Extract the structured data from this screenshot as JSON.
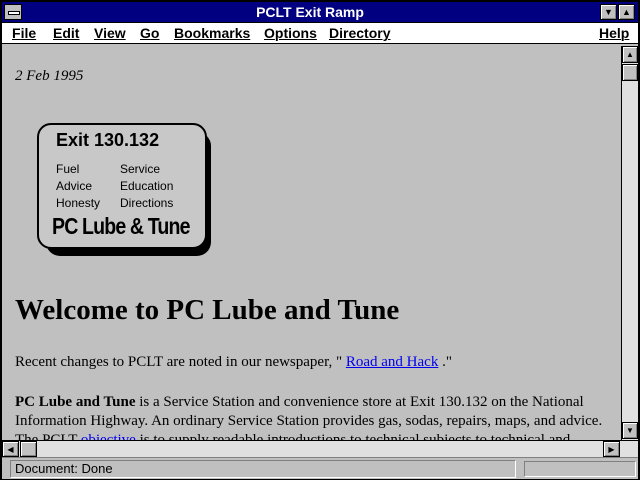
{
  "window": {
    "title": "PCLT Exit Ramp"
  },
  "menubar": {
    "items": [
      {
        "underline": "F",
        "rest": "ile"
      },
      {
        "underline": "E",
        "rest": "dit"
      },
      {
        "underline": "V",
        "rest": "iew"
      },
      {
        "underline": "G",
        "rest": "o"
      },
      {
        "underline": "B",
        "rest": "ookmarks"
      },
      {
        "underline": "O",
        "rest": "ptions"
      },
      {
        "underline": "D",
        "rest": "irectory"
      },
      {
        "underline": "H",
        "rest": "elp"
      }
    ]
  },
  "page": {
    "date": "2 Feb 1995",
    "logo": {
      "exit": "Exit 130.132",
      "col1": [
        "Fuel",
        "Advice",
        "Honesty"
      ],
      "col2": [
        "Service",
        "Education",
        "Directions"
      ],
      "brand": "PC Lube & Tune"
    },
    "heading": "Welcome to PC Lube and Tune",
    "recent_changes": {
      "prefix": "Recent changes to PCLT are noted in our newspaper, \" ",
      "link": "Road and Hack",
      "suffix": " .\""
    },
    "intro": {
      "bold": "PC Lube and Tune",
      "text": " is a Service Station and convenience store at Exit 130.132 on the National Information Highway. An ordinary Service Station provides gas, sodas, repairs, maps, and advice. The PCLT ",
      "link": "objective",
      "tail": " is to supply readable introductions to technical subjects to technical and"
    }
  },
  "status": {
    "text": "Document: Done"
  }
}
